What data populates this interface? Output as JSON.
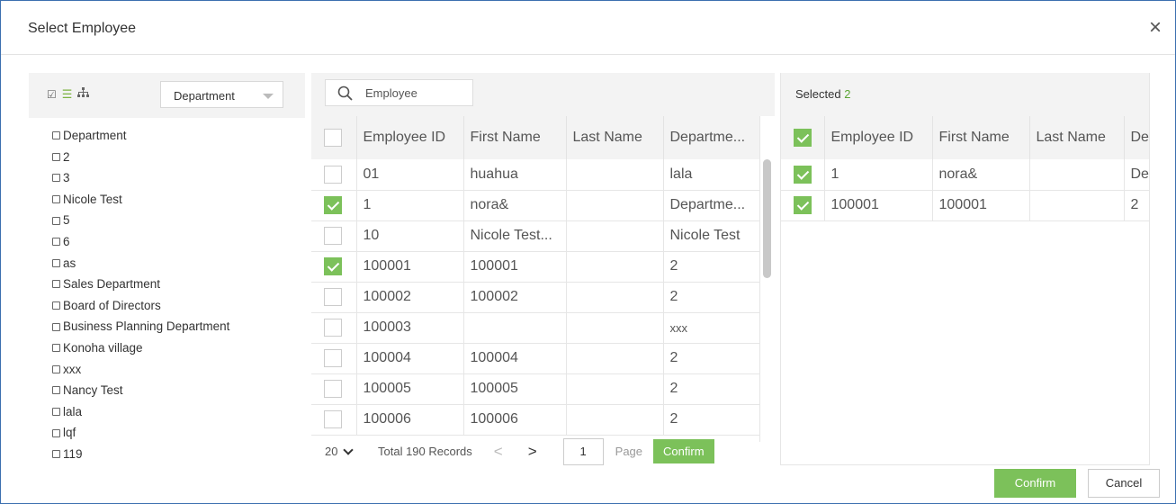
{
  "dialog": {
    "title": "Select Employee",
    "close_icon": "×"
  },
  "tree": {
    "dropdown_value": "Department",
    "items": [
      "Department",
      "2",
      "3",
      "Nicole Test",
      "5",
      "6",
      "as",
      "Sales Department",
      "Board of Directors",
      "Business Planning Department",
      "Konoha village",
      "xxx",
      "Nancy Test",
      "lala",
      "lqf",
      "119"
    ]
  },
  "employees": {
    "search_placeholder": "Employee",
    "columns": [
      "Employee ID",
      "First Name",
      "Last Name",
      "Departme..."
    ],
    "rows": [
      {
        "checked": false,
        "id": "01",
        "first": "huahua",
        "last": "",
        "dept": "lala"
      },
      {
        "checked": true,
        "id": "1",
        "first": "nora&",
        "last": "",
        "dept": "Departme..."
      },
      {
        "checked": false,
        "id": "10",
        "first": "Nicole Test...",
        "last": "",
        "dept": "Nicole Test"
      },
      {
        "checked": true,
        "id": "100001",
        "first": "100001",
        "last": "",
        "dept": "2"
      },
      {
        "checked": false,
        "id": "100002",
        "first": "100002",
        "last": "",
        "dept": "2"
      },
      {
        "checked": false,
        "id": "100003",
        "first": "",
        "last": "",
        "dept": "xxx"
      },
      {
        "checked": false,
        "id": "100004",
        "first": "100004",
        "last": "",
        "dept": "2"
      },
      {
        "checked": false,
        "id": "100005",
        "first": "100005",
        "last": "",
        "dept": "2"
      },
      {
        "checked": false,
        "id": "100006",
        "first": "100006",
        "last": "",
        "dept": "2"
      }
    ],
    "pager": {
      "page_size": "20",
      "total": "Total 190 Records",
      "prev": "<",
      "next": ">",
      "page": "1",
      "page_label": "Page",
      "confirm": "Confirm"
    }
  },
  "selected": {
    "label": "Selected",
    "count": "2",
    "columns": [
      "Employee ID",
      "First Name",
      "Last Name",
      "De"
    ],
    "rows": [
      {
        "id": "1",
        "first": "nora&",
        "last": "",
        "dept": "De"
      },
      {
        "id": "100001",
        "first": "100001",
        "last": "",
        "dept": "2"
      }
    ]
  },
  "footer": {
    "confirm": "Confirm",
    "cancel": "Cancel"
  },
  "colors": {
    "accent": "#7cc15a",
    "border": "#3c6fb0",
    "header_bg": "#f3f3f3"
  },
  "icons": [
    "checkbox-icon",
    "list-icon",
    "org-tree-icon",
    "search-icon",
    "close-icon",
    "chevron-down-icon"
  ]
}
